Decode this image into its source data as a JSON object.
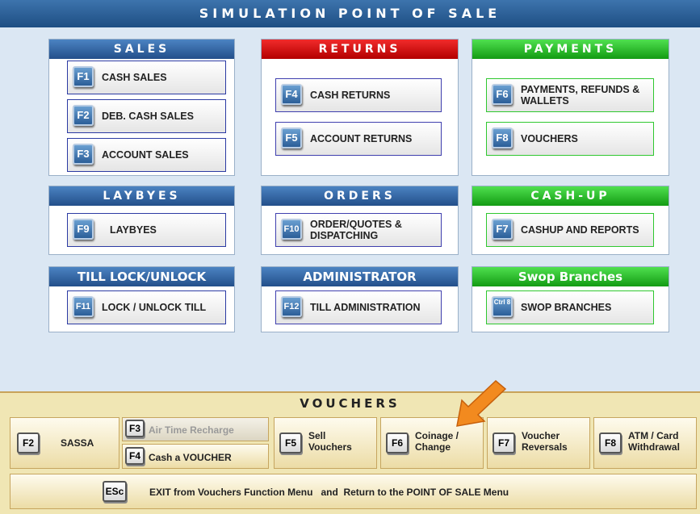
{
  "header": {
    "title": "SIMULATION POINT OF SALE"
  },
  "panels": {
    "sales": {
      "title": "SALES",
      "buttons": [
        {
          "key": "F1",
          "label": "CASH SALES"
        },
        {
          "key": "F2",
          "label": "DEB. CASH SALES"
        },
        {
          "key": "F3",
          "label": "ACCOUNT SALES"
        }
      ]
    },
    "returns": {
      "title": "RETURNS",
      "buttons": [
        {
          "key": "F4",
          "label": "CASH RETURNS"
        },
        {
          "key": "F5",
          "label": "ACCOUNT RETURNS"
        }
      ]
    },
    "payments": {
      "title": "PAYMENTS",
      "buttons": [
        {
          "key": "F6",
          "label": "PAYMENTS, REFUNDS & WALLETS"
        },
        {
          "key": "F8",
          "label": "VOUCHERS"
        }
      ]
    },
    "laybyes": {
      "title": "LAYBYES",
      "buttons": [
        {
          "key": "F9",
          "label": "LAYBYES"
        }
      ]
    },
    "orders": {
      "title": "ORDERS",
      "buttons": [
        {
          "key": "F10",
          "label": "ORDER/QUOTES & DISPATCHING"
        }
      ]
    },
    "cashup": {
      "title": "CASH-UP",
      "buttons": [
        {
          "key": "F7",
          "label": "CASHUP AND REPORTS"
        }
      ]
    },
    "tilllock": {
      "title": "TILL LOCK/UNLOCK",
      "buttons": [
        {
          "key": "F11",
          "label": "LOCK / UNLOCK TILL"
        }
      ]
    },
    "admin": {
      "title": "ADMINISTRATOR",
      "buttons": [
        {
          "key": "F12",
          "label": "TILL ADMINISTRATION"
        }
      ]
    },
    "swop": {
      "title": "Swop Branches",
      "buttons": [
        {
          "key": "Ctrl 8",
          "label": "SWOP BRANCHES"
        }
      ]
    }
  },
  "vouchers": {
    "title": "VOUCHERS",
    "sassa": {
      "key": "F2",
      "label": "SASSA"
    },
    "airtime": {
      "key": "F3",
      "label": "Air Time Recharge"
    },
    "cash_voucher": {
      "key": "F4",
      "label": "Cash a VOUCHER"
    },
    "sell": {
      "key": "F5",
      "label": "Sell Vouchers"
    },
    "coinage": {
      "key": "F6",
      "label": "Coinage / Change"
    },
    "reversals": {
      "key": "F7",
      "label": "Voucher Reversals"
    },
    "atm": {
      "key": "F8",
      "label": "ATM / Card Withdrawal"
    },
    "exit": {
      "key": "ESc",
      "label": "EXIT from Vouchers Function Menu   and  Return to the POINT OF SALE Menu"
    }
  },
  "colors": {
    "header_blue": "#234f8a",
    "returns_red": "#b30000",
    "payments_green": "#139b13",
    "voucher_bg": "#f0e6b4"
  },
  "icons": {
    "pointer": "orange-arrow-icon"
  }
}
